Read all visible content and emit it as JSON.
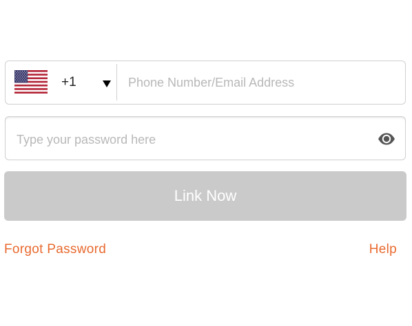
{
  "login_form": {
    "country": {
      "flag_icon": "us-flag-icon",
      "code": "+1",
      "dropdown_icon": "caret-down-icon"
    },
    "phone_field": {
      "value": "",
      "placeholder": "Phone Number/Email Address"
    },
    "password_field": {
      "value": "",
      "placeholder": "Type your password here",
      "visibility_icon": "eye-icon"
    },
    "submit_button": {
      "label": "Link Now",
      "state": "disabled"
    },
    "links": {
      "forgot_password": "Forgot Password",
      "help": "Help"
    }
  },
  "colors": {
    "accent": "#e8692e",
    "button_disabled_bg": "#cacaca",
    "border": "#cfcfcf",
    "placeholder": "#b8b8b8"
  }
}
